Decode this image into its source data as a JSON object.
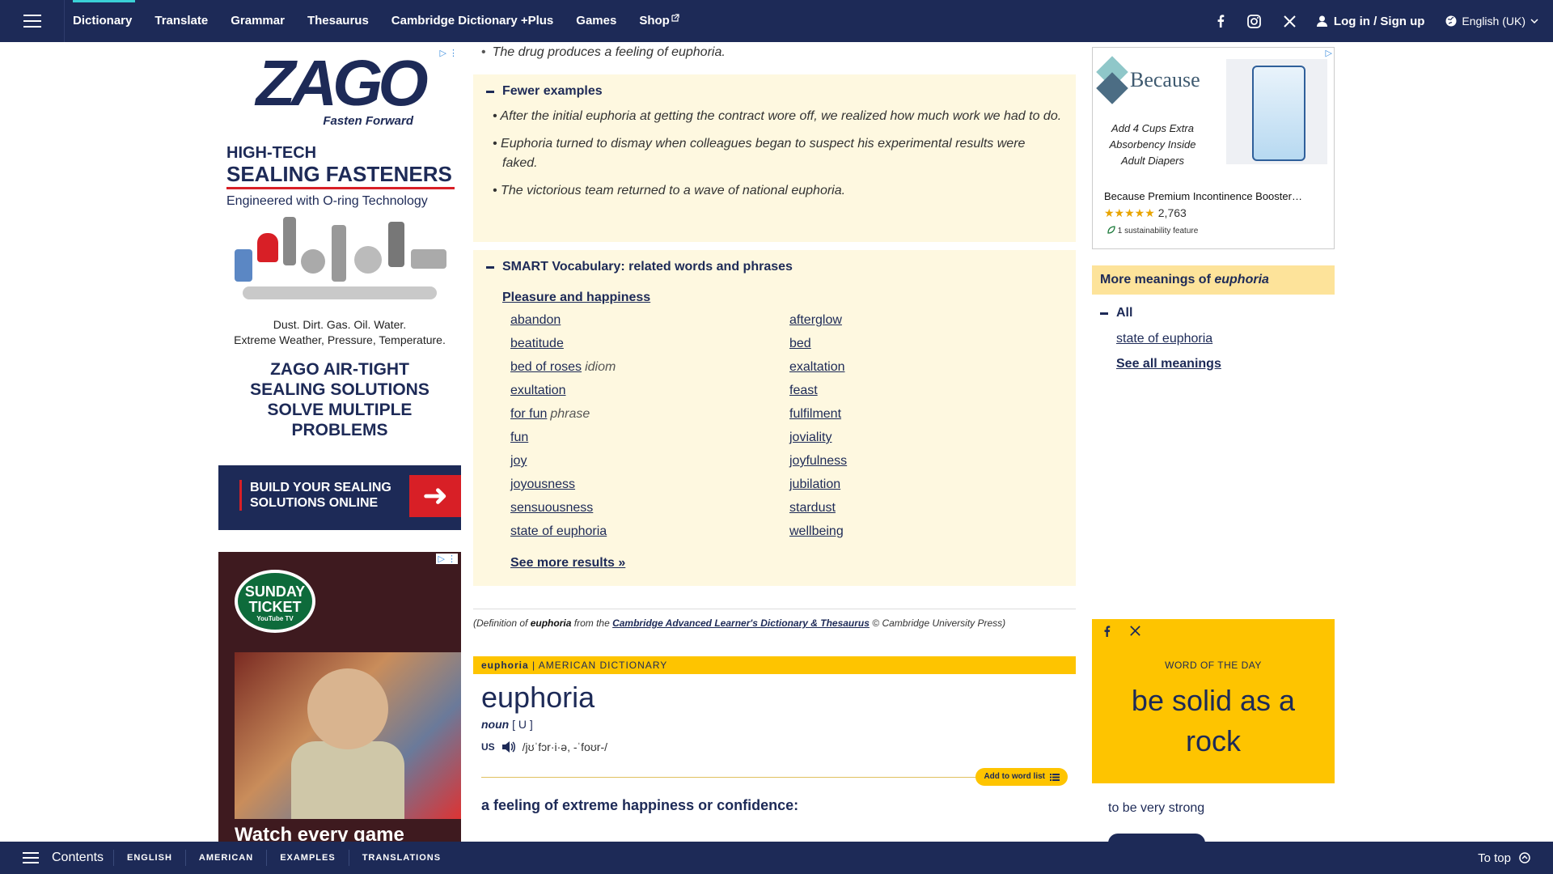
{
  "nav": {
    "items": [
      {
        "label": "Dictionary"
      },
      {
        "label": "Translate"
      },
      {
        "label": "Grammar"
      },
      {
        "label": "Thesaurus"
      },
      {
        "label": "Cambridge Dictionary +Plus"
      },
      {
        "label": "Games"
      },
      {
        "label": "Shop"
      }
    ],
    "login": "Log in / Sign up",
    "language": "English (UK)"
  },
  "ads": {
    "zago": {
      "brand": "ZAGO",
      "tagline": "Fasten Forward",
      "headline1": "HIGH-TECH",
      "headline2": "SEALING FASTENERS",
      "subline": "Engineered with O-ring Technology",
      "para1": "Dust. Dirt. Gas. Oil. Water.",
      "para2": "Extreme Weather, Pressure, Temperature.",
      "cta_big": "ZAGO AIR-TIGHT SEALING SOLUTIONS SOLVE MULTIPLE PROBLEMS",
      "bar_text": "BUILD YOUR SEALING SOLUTIONS ONLINE"
    },
    "nfl": {
      "badge": "SUNDAY TICKET",
      "badge_sub": "YouTube TV",
      "text": "Watch every game"
    },
    "because": {
      "brand": "Because",
      "tag": "Add 4 Cups Extra Absorbency Inside Adult Diapers",
      "title": "Because Premium Incontinence Booster…",
      "rating_count": "2,763",
      "sustainability": "1 sustainability feature"
    }
  },
  "main": {
    "example_top": "The drug produces a feeling of euphoria.",
    "fewer": {
      "heading": "Fewer examples",
      "items": [
        "After the initial euphoria at getting the contract wore off, we realized how much work we had to do.",
        "Euphoria turned to dismay when colleagues began to suspect his experimental results were faked.",
        "The victorious team returned to a wave of national euphoria."
      ]
    },
    "smart": {
      "heading": "SMART Vocabulary: related words and phrases",
      "topic": "Pleasure and happiness",
      "left": [
        {
          "word": "abandon",
          "tag": ""
        },
        {
          "word": "beatitude",
          "tag": ""
        },
        {
          "word": "bed of roses",
          "tag": "idiom"
        },
        {
          "word": "exultation",
          "tag": ""
        },
        {
          "word": "for fun",
          "tag": "phrase"
        },
        {
          "word": "fun",
          "tag": ""
        },
        {
          "word": "joy",
          "tag": ""
        },
        {
          "word": "joyousness",
          "tag": ""
        },
        {
          "word": "sensuousness",
          "tag": ""
        },
        {
          "word": "state of euphoria",
          "tag": ""
        }
      ],
      "right": [
        {
          "word": "afterglow"
        },
        {
          "word": "bed"
        },
        {
          "word": "exaltation"
        },
        {
          "word": "feast"
        },
        {
          "word": "fulfilment"
        },
        {
          "word": "joviality"
        },
        {
          "word": "joyfulness"
        },
        {
          "word": "jubilation"
        },
        {
          "word": "stardust"
        },
        {
          "word": "wellbeing"
        }
      ],
      "see_more": "See more results »"
    },
    "source": {
      "prefix": "(Definition of",
      "word": "euphoria",
      "from": "from the",
      "book": "Cambridge Advanced Learner's Dictionary & Thesaurus",
      "suffix": "© Cambridge University Press)"
    },
    "american": {
      "bar_word": "euphoria",
      "bar_label": "| AMERICAN DICTIONARY",
      "headword": "euphoria",
      "pos": "noun",
      "grammar": "[ U ]",
      "region": "US",
      "pron": "/jʊˈfɔr·i·ə, -ˈfoʊr-/",
      "add_wordlist": "Add to word list",
      "definition": "a feeling of extreme happiness or confidence:"
    }
  },
  "right": {
    "more_meanings_prefix": "More meanings of",
    "more_meanings_word": "euphoria",
    "all_label": "All",
    "link": "state of euphoria",
    "see_all": "See all meanings",
    "wotd_label": "WORD OF THE DAY",
    "wotd_word": "be solid as a rock",
    "wotd_def": "to be very strong"
  },
  "bottom": {
    "contents": "Contents",
    "items": [
      "ENGLISH",
      "AMERICAN",
      "EXAMPLES",
      "TRANSLATIONS"
    ],
    "to_top": "To top"
  },
  "colors": {
    "navy": "#1d2a57",
    "yellow": "#fec400",
    "cream": "#fef8e0",
    "teal_accent": "#3ad0d6"
  }
}
